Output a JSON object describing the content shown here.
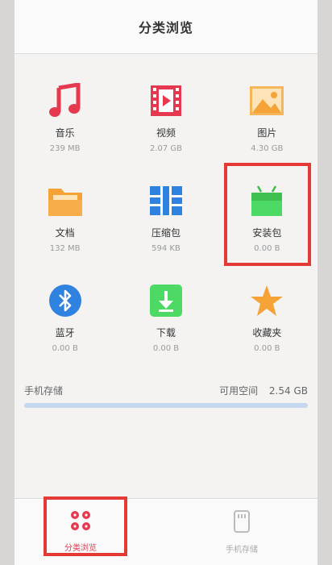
{
  "header": {
    "title": "分类浏览"
  },
  "categories": [
    {
      "name": "音乐",
      "size": "239 MB",
      "icon": "music-icon",
      "color": "#e63950"
    },
    {
      "name": "视频",
      "size": "2.07 GB",
      "icon": "video-icon",
      "color": "#e63950"
    },
    {
      "name": "图片",
      "size": "4.30 GB",
      "icon": "picture-icon",
      "color": "#f5a337"
    },
    {
      "name": "文档",
      "size": "132 MB",
      "icon": "folder-icon",
      "color": "#f5a337"
    },
    {
      "name": "压缩包",
      "size": "594 KB",
      "icon": "archive-icon",
      "color": "#2f82e0"
    },
    {
      "name": "安装包",
      "size": "0.00 B",
      "icon": "android-package-icon",
      "color": "#4cd964"
    },
    {
      "name": "蓝牙",
      "size": "0.00 B",
      "icon": "bluetooth-icon",
      "color": "#2f82e0"
    },
    {
      "name": "下载",
      "size": "0.00 B",
      "icon": "download-icon",
      "color": "#4cd964"
    },
    {
      "name": "收藏夹",
      "size": "0.00 B",
      "icon": "star-icon",
      "color": "#f5a337"
    }
  ],
  "storage": {
    "label": "手机存储",
    "free_label": "可用空间",
    "free_value": "2.54 GB"
  },
  "bottom_nav": [
    {
      "label": "分类浏览",
      "icon": "category-grid-icon",
      "active": true,
      "color": "#e63950"
    },
    {
      "label": "手机存储",
      "icon": "phone-storage-icon",
      "active": false,
      "color": "#aaaaaa"
    }
  ]
}
